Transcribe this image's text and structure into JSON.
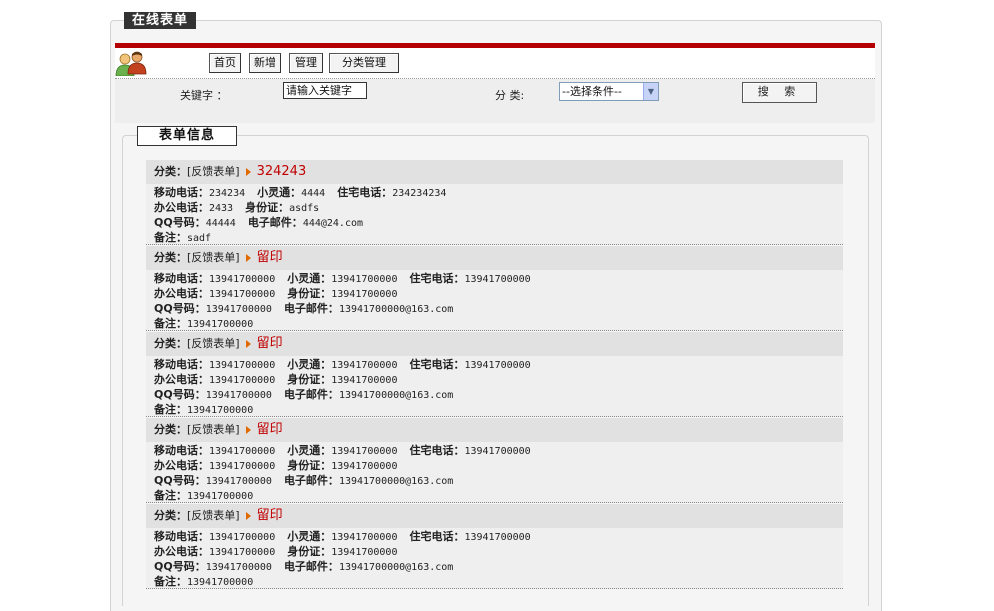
{
  "header": {
    "title": "在线表单"
  },
  "nav": {
    "home": "首页",
    "add": "新增",
    "manage": "管理",
    "category_manage": "分类管理"
  },
  "search": {
    "keyword_label": "关键字 ：",
    "keyword_value": "请输入关键字",
    "category_label": "分 类:",
    "category_selected": "--选择条件--",
    "search_button": "搜 索"
  },
  "section": {
    "title": "表单信息"
  },
  "labels": {
    "category": "分类：",
    "mobile": "移动电话：",
    "phs": "小灵通：",
    "home_phone": "住宅电话：",
    "office_phone": "办公电话：",
    "id_card": "身份证：",
    "qq": "QQ号码：",
    "email": "电子邮件：",
    "remark": "备注："
  },
  "records": [
    {
      "category": "[反馈表单]",
      "title": "324243",
      "mobile": "234234",
      "phs": "4444",
      "home_phone": "234234234",
      "office_phone": "2433",
      "id_card": "asdfs",
      "qq": "44444",
      "email": "444@24.com",
      "remark": "sadf"
    },
    {
      "category": "[反馈表单]",
      "title": "留印",
      "mobile": "13941700000",
      "phs": "13941700000",
      "home_phone": "13941700000",
      "office_phone": "13941700000",
      "id_card": "13941700000",
      "qq": "13941700000",
      "email": "13941700000@163.com",
      "remark": "13941700000"
    },
    {
      "category": "[反馈表单]",
      "title": "留印",
      "mobile": "13941700000",
      "phs": "13941700000",
      "home_phone": "13941700000",
      "office_phone": "13941700000",
      "id_card": "13941700000",
      "qq": "13941700000",
      "email": "13941700000@163.com",
      "remark": "13941700000"
    },
    {
      "category": "[反馈表单]",
      "title": "留印",
      "mobile": "13941700000",
      "phs": "13941700000",
      "home_phone": "13941700000",
      "office_phone": "13941700000",
      "id_card": "13941700000",
      "qq": "13941700000",
      "email": "13941700000@163.com",
      "remark": "13941700000"
    },
    {
      "category": "[反馈表单]",
      "title": "留印",
      "mobile": "13941700000",
      "phs": "13941700000",
      "home_phone": "13941700000",
      "office_phone": "13941700000",
      "id_card": "13941700000",
      "qq": "13941700000",
      "email": "13941700000@163.com",
      "remark": "13941700000"
    }
  ]
}
